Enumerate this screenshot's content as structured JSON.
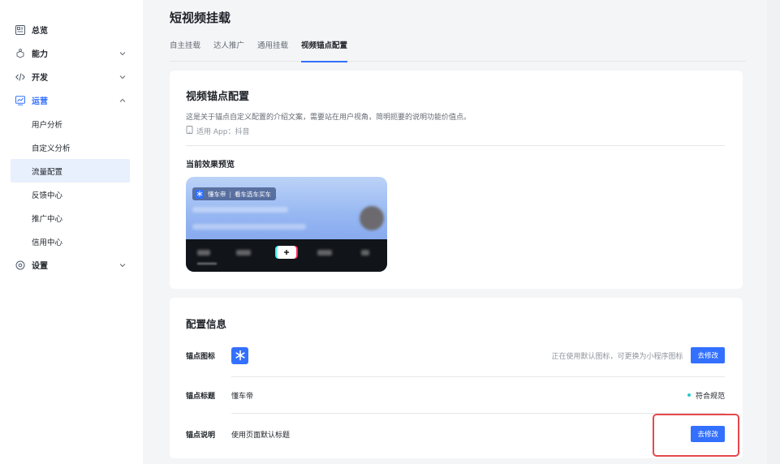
{
  "sidebar": {
    "items": [
      {
        "label": "总览",
        "icon": "dashboard-icon",
        "expandable": false
      },
      {
        "label": "能力",
        "icon": "capability-icon",
        "expandable": true
      },
      {
        "label": "开发",
        "icon": "code-icon",
        "expandable": true
      },
      {
        "label": "运营",
        "icon": "operation-chart-icon",
        "expandable": true,
        "expanded": true,
        "children": [
          {
            "label": "用户分析"
          },
          {
            "label": "自定义分析"
          },
          {
            "label": "流量配置",
            "selected": true
          },
          {
            "label": "反馈中心"
          },
          {
            "label": "推广中心"
          },
          {
            "label": "信用中心"
          }
        ]
      },
      {
        "label": "设置",
        "icon": "settings-icon",
        "expandable": true
      }
    ]
  },
  "page": {
    "title": "短视频挂载",
    "tabs": [
      {
        "label": "自主挂载"
      },
      {
        "label": "达人推广"
      },
      {
        "label": "通用挂载"
      },
      {
        "label": "视频锚点配置",
        "active": true
      }
    ]
  },
  "anchor_card": {
    "title": "视频锚点配置",
    "description": "这是关于锚点自定义配置的介绍文案，需要站在用户视角，简明扼要的说明功能价值点。",
    "app_label": "适用 App：",
    "app_value": "抖音",
    "preview_title": "当前效果预览",
    "preview": {
      "chip_name": "懂车帝",
      "chip_sep": "|",
      "chip_text": "看车选车买车"
    }
  },
  "config_card": {
    "title": "配置信息",
    "rows": [
      {
        "label": "锚点图标",
        "hint": "正在使用默认图标，可更换为小程序图标",
        "button": "去修改"
      },
      {
        "label": "锚点标题",
        "value": "懂车帝",
        "status": "符合规范"
      },
      {
        "label": "锚点说明",
        "value": "使用页面默认标题",
        "button": "去修改"
      }
    ]
  },
  "colors": {
    "accent": "#3370ff",
    "highlight": "#e5484d",
    "status_ok": "#2ec7c9"
  }
}
